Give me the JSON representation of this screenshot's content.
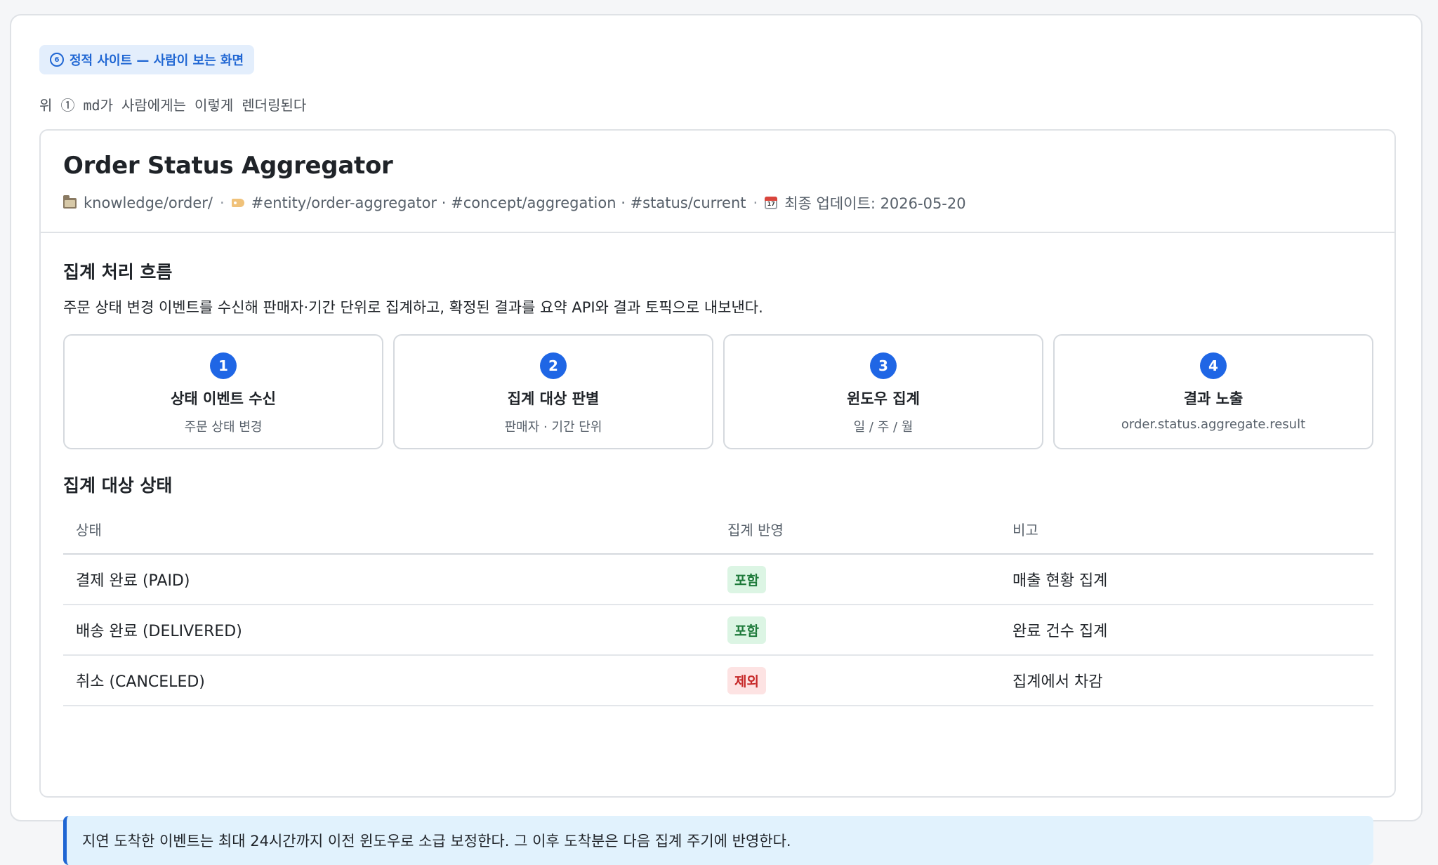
{
  "section": {
    "badge_number": "6",
    "badge_label": "정적 사이트 — 사람이 보는 화면",
    "caption": "위 ① md가 사람에게는 이렇게 렌더링된다"
  },
  "doc": {
    "title": "Order Status Aggregator",
    "path": "knowledge/order/",
    "tags": "#entity/order-aggregator · #concept/aggregation · #status/current",
    "updated": "최종 업데이트: 2026-05-20",
    "icons": [
      "folder-icon",
      "tag-icon",
      "calendar-icon"
    ]
  },
  "flow": {
    "title": "집계 처리 흐름",
    "description": "주문 상태 변경 이벤트를 수신해 판매자·기간 단위로 집계하고, 확정된 결과를 요약 API와 결과 토픽으로 내보낸다.",
    "steps": [
      {
        "num": "1",
        "title": "상태 이벤트 수신",
        "sub": "주문 상태 변경"
      },
      {
        "num": "2",
        "title": "집계 대상 판별",
        "sub": "판매자 · 기간 단위"
      },
      {
        "num": "3",
        "title": "윈도우 집계",
        "sub": "일 / 주 / 월"
      },
      {
        "num": "4",
        "title": "결과 노출",
        "sub": "order.status.aggregate.result"
      }
    ]
  },
  "status": {
    "title": "집계 대상 상태",
    "headers": [
      "상태",
      "집계 반영",
      "비고"
    ],
    "rows": [
      {
        "status": "결제 완료 (PAID)",
        "reflect": "포함",
        "kind": "include",
        "note": "매출 현황 집계"
      },
      {
        "status": "배송 완료 (DELIVERED)",
        "reflect": "포함",
        "kind": "include",
        "note": "완료 건수 집계"
      },
      {
        "status": "취소 (CANCELED)",
        "reflect": "제외",
        "kind": "exclude",
        "note": "집계에서 차감"
      }
    ]
  },
  "note": "지연 도착한 이벤트는 최대 24시간까지 이전 윈도우로 소급 보정한다. 그 이후 도착분은 다음 집계 주기에 반영한다.",
  "colors": {
    "accent": "#1f66e5",
    "include_bg": "#dcf5e4",
    "include_fg": "#1d7a3a",
    "exclude_bg": "#fde3e3",
    "exclude_fg": "#c62828",
    "note_bg": "#e1f2fd"
  }
}
